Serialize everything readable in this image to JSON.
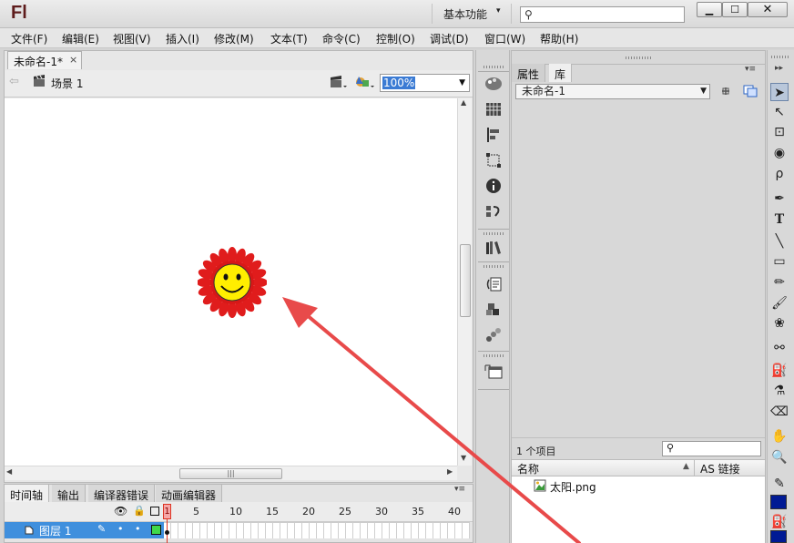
{
  "app": {
    "logo": "Fl",
    "workspace": "基本功能"
  },
  "menu": [
    "文件(F)",
    "编辑(E)",
    "视图(V)",
    "插入(I)",
    "修改(M)",
    "文本(T)",
    "命令(C)",
    "控制(O)",
    "调试(D)",
    "窗口(W)",
    "帮助(H)"
  ],
  "document": {
    "tab_title": "未命名-1*",
    "scene": "场景 1",
    "zoom": "100%"
  },
  "timeline": {
    "tabs": [
      "时间轴",
      "输出",
      "编译器错误",
      "动画编辑器"
    ],
    "frame_numbers": [
      "1",
      "5",
      "10",
      "15",
      "20",
      "25",
      "30",
      "35",
      "40"
    ],
    "layer_name": "图层 1"
  },
  "library": {
    "tabs": [
      "属性",
      "库"
    ],
    "document": "未命名-1",
    "count": "1 个项目",
    "col_name": "名称",
    "col_linkage": "AS 链接",
    "items": [
      {
        "name": "太阳.png"
      }
    ]
  },
  "colors": {
    "stroke": "#001a94",
    "fill": "#001a94",
    "layer_highlight": "#3f8fdd",
    "annotation_arrow": "#e84a4a"
  },
  "icons": [
    "search-icon",
    "scene-icon",
    "edit-scene-icon",
    "edit-symbol-icon",
    "selection-tool-icon",
    "text-tool-icon",
    "hand-tool-icon",
    "zoom-tool-icon"
  ]
}
